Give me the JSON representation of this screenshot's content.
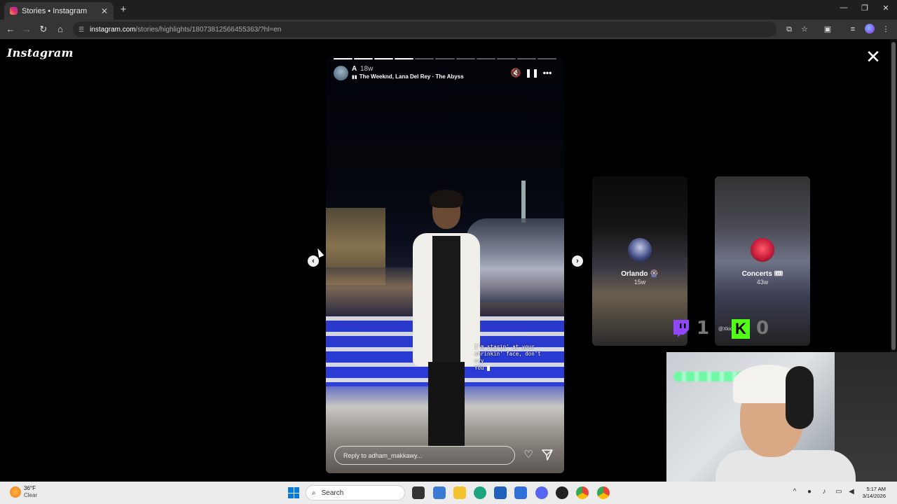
{
  "browser": {
    "tab_title": "Stories • Instagram",
    "tab_close": "✕",
    "new_tab": "+",
    "url_host": "instagram.com",
    "url_path": "/stories/highlights/18073812566455363/?hl=en",
    "window_controls": [
      "—",
      "❐",
      "✕"
    ]
  },
  "page": {
    "logo_text": "Instagram",
    "close_icon": "✕"
  },
  "story": {
    "progress_total": 11,
    "progress_done": 4,
    "username": "A",
    "age": "18w",
    "music": "The Weeknd, Lana Del Rey · The Abyss",
    "lyrics": [
      "I'm starin' at your",
      "shrinkin' face, don't",
      "cry",
      "You"
    ],
    "reply_placeholder": "Reply to adham_makkawy...",
    "prev_label": "‹",
    "next_label": "›"
  },
  "highlights": [
    {
      "title": "Orlando 🎡",
      "age": "15w"
    },
    {
      "title": "Concerts 🎟",
      "age": "43w"
    }
  ],
  "overlay": {
    "twitch_count": "1",
    "kick_count": "0",
    "kick_letter": "K",
    "x_label": "@Xkick"
  },
  "taskbar": {
    "temperature": "36°F",
    "condition": "Clear",
    "search_placeholder": "Search",
    "time": "5:17 AM",
    "date": "3/14/2026"
  },
  "colors": {
    "accent_kick": "#53fc18",
    "accent_twitch": "#9146ff"
  }
}
